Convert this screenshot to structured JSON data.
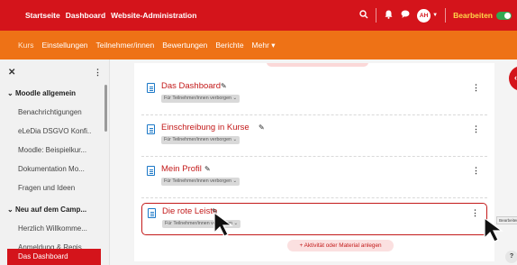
{
  "topbar": {
    "nav": [
      "Startseite",
      "Dashboard",
      "Website-Administration"
    ],
    "user_initials": "AH",
    "edit_mode_label": "Bearbeiten"
  },
  "course_nav": {
    "items": [
      "Kurs",
      "Einstellungen",
      "Teilnehmer/innen",
      "Bewertungen",
      "Berichte",
      "Mehr ▾"
    ],
    "active_index": 0
  },
  "sidebar": {
    "sections": [
      {
        "title": "Moodle allgemein",
        "items": [
          "Benachrichtigungen",
          "eLeDia DSGVO Konfi..",
          "Moodle: Beispielkur...",
          "Dokumentation Mo...",
          "Fragen und Ideen"
        ]
      },
      {
        "title": "Neu auf dem Camp...",
        "items": [
          "Herzlich Willkomme...",
          "Anmeldung & Regis...",
          "Das Dashboard"
        ]
      }
    ],
    "active_item": "Das Dashboard"
  },
  "activities": [
    {
      "title": "Das Dashboard",
      "badge": "Für Teilnehmer/innen verborgen ⌄"
    },
    {
      "title": "Einschreibung in Kurse",
      "badge": "Für Teilnehmer/innen verborgen ⌄"
    },
    {
      "title": "Mein Profil",
      "badge": "Für Teilnehmer/innen verborgen ⌄"
    },
    {
      "title": "Die rote Leiste",
      "badge": "Für Teilnehmer/innen verborgen ⌄"
    }
  ],
  "add_activity_label": "+ Aktivität oder Material anlegen",
  "tooltip": "Bearbeiten",
  "help_label": "?",
  "colors": {
    "brand_red": "#d4141b",
    "brand_orange": "#ee7216",
    "link_red": "#c31a1a",
    "edit_yellow": "#ffd84a",
    "toggle_green": "#34a853"
  },
  "icons": {
    "search": "search-icon",
    "notifications": "bell-icon",
    "messages": "chat-icon",
    "page": "page-icon",
    "edit_title": "pencil-icon",
    "actions": "kebab-menu-icon"
  }
}
